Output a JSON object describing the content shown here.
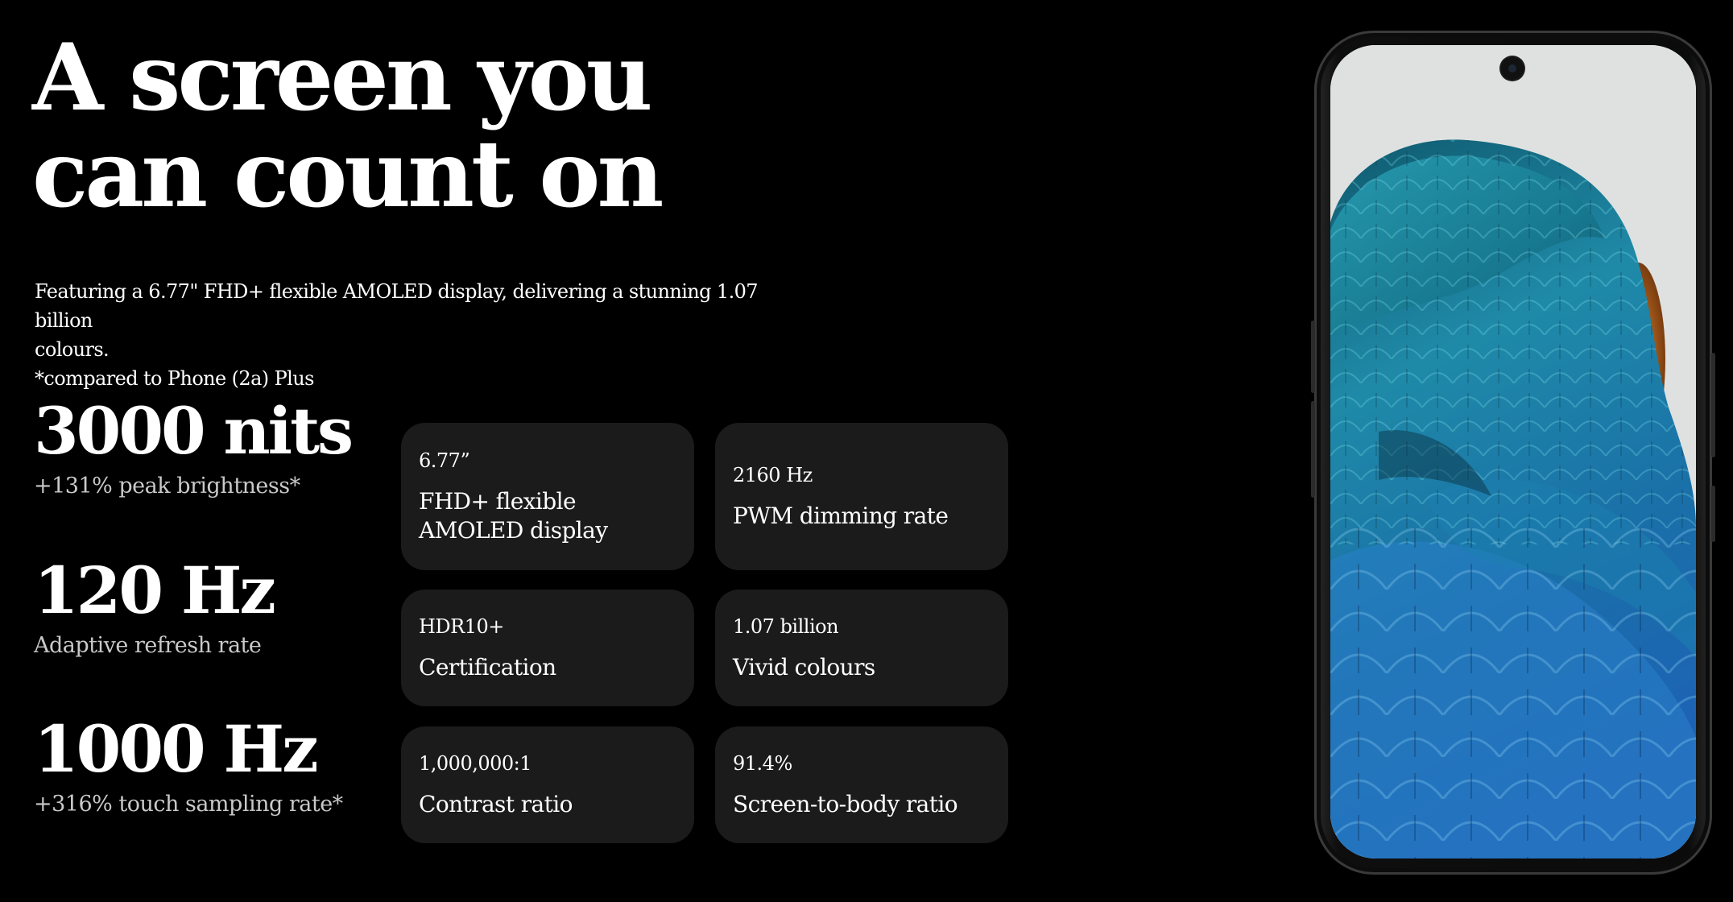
{
  "headline": {
    "line1": "A screen you",
    "line2": "can count on"
  },
  "intro": {
    "line1": "Featuring a 6.77\" FHD+ flexible AMOLED display, delivering a stunning 1.07 billion",
    "line2": "colours.",
    "footnote": "*compared to Phone (2a) Plus"
  },
  "stats": [
    {
      "value": "3000 nits",
      "label": "+131% peak brightness*"
    },
    {
      "value": "120 Hz",
      "label": "Adaptive refresh rate"
    },
    {
      "value": "1000 Hz",
      "label": "+316% touch sampling rate*"
    }
  ],
  "cards": [
    {
      "value": "6.77”",
      "label": "FHD+ flexible AMOLED display"
    },
    {
      "value": "2160 Hz",
      "label": "PWM dimming rate"
    },
    {
      "value": "HDR10+",
      "label": "Certification"
    },
    {
      "value": "1.07 billion",
      "label": "Vivid colours"
    },
    {
      "value": "1,000,000:1",
      "label": "Contrast ratio"
    },
    {
      "value": "91.4%",
      "label": "Screen-to-body ratio"
    }
  ],
  "phone": {
    "icon": "smartphone-with-parrot-wallpaper",
    "colors": {
      "screen_bg": "#dfe1e0",
      "feather_dark": "#0c3f6a",
      "feather_teal": "#1f8fb0",
      "feather_orange": "#c96a1c"
    }
  },
  "colors": {
    "background": "#000000",
    "card": "#1b1b1b",
    "text": "#ffffff",
    "muted_text": "#c9c9c9"
  }
}
